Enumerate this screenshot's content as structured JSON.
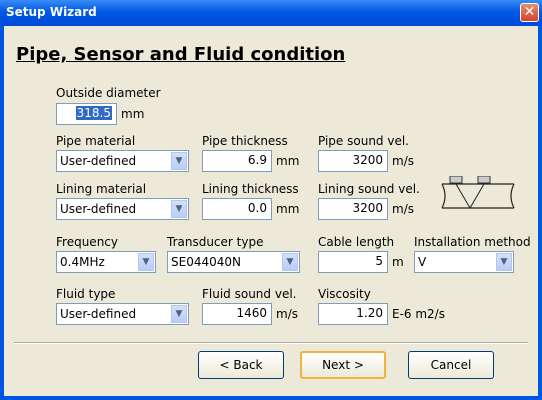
{
  "window": {
    "title": "Setup Wizard",
    "close_glyph": "✕"
  },
  "heading": "Pipe, Sensor and Fluid condition",
  "outside_diameter": {
    "label": "Outside diameter",
    "value": "318.5",
    "unit": "mm"
  },
  "pipe_material": {
    "label": "Pipe material",
    "value": "User-defined"
  },
  "pipe_thickness": {
    "label": "Pipe thickness",
    "value": "6.9",
    "unit": "mm"
  },
  "pipe_sound_vel": {
    "label": "Pipe sound vel.",
    "value": "3200",
    "unit": "m/s"
  },
  "lining_material": {
    "label": "Lining material",
    "value": "User-defined"
  },
  "lining_thickness": {
    "label": "Lining thickness",
    "value": "0.0",
    "unit": "mm"
  },
  "lining_sound_vel": {
    "label": "Lining sound vel.",
    "value": "3200",
    "unit": "m/s"
  },
  "frequency": {
    "label": "Frequency",
    "value": "0.4MHz"
  },
  "transducer_type": {
    "label": "Transducer type",
    "value": "SE044040N"
  },
  "cable_length": {
    "label": "Cable length",
    "value": "5",
    "unit": "m"
  },
  "installation_method": {
    "label": "Installation method",
    "value": "V"
  },
  "fluid_type": {
    "label": "Fluid type",
    "value": "User-defined"
  },
  "fluid_sound_vel": {
    "label": "Fluid sound vel.",
    "value": "1460",
    "unit": "m/s"
  },
  "viscosity": {
    "label": "Viscosity",
    "value": "1.20",
    "unit": "E-6 m2/s"
  },
  "buttons": {
    "back": "< Back",
    "next": "Next >",
    "cancel": "Cancel"
  },
  "icons": {
    "dropdown": "chevron-down-icon",
    "diagram": "v-method-pipe-diagram"
  }
}
